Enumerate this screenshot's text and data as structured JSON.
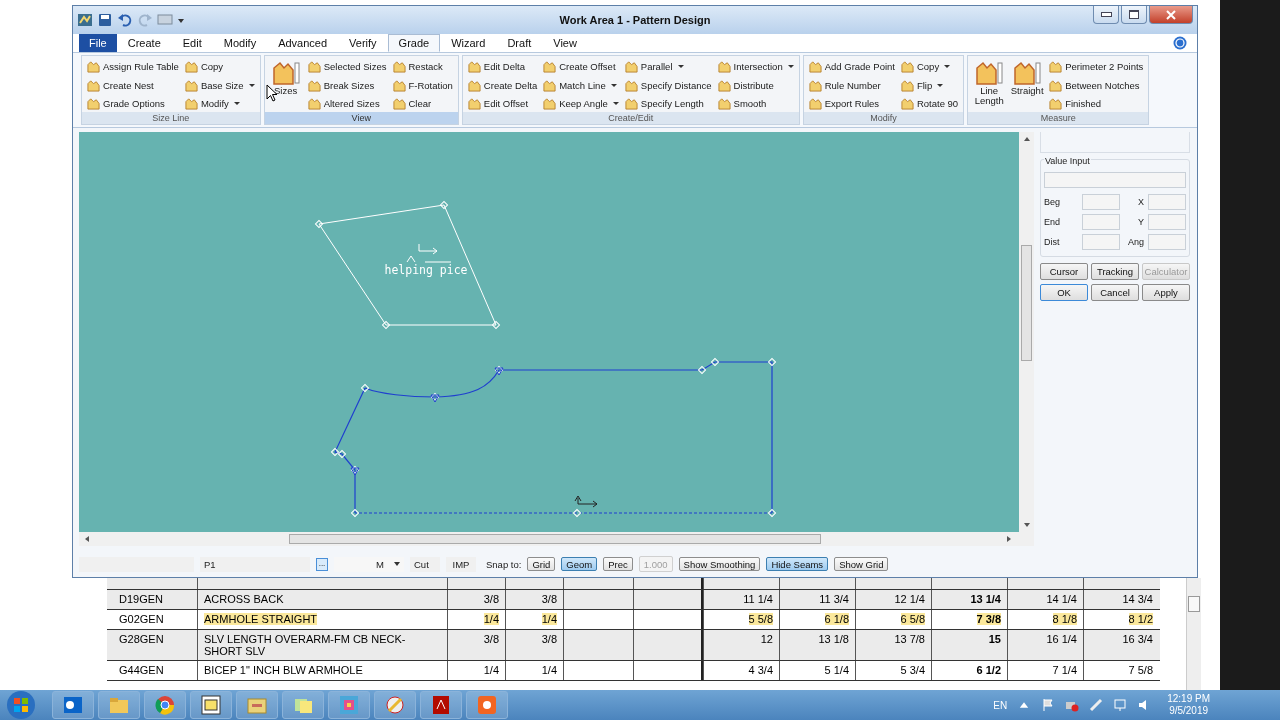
{
  "window": {
    "title": "Work Area 1 - Pattern Design"
  },
  "tabs": [
    {
      "label": "File",
      "kind": "file",
      "selected": false
    },
    {
      "label": "Create",
      "kind": "tab",
      "selected": false
    },
    {
      "label": "Edit",
      "kind": "tab",
      "selected": false
    },
    {
      "label": "Modify",
      "kind": "tab",
      "selected": false
    },
    {
      "label": "Advanced",
      "kind": "tab",
      "selected": false
    },
    {
      "label": "Verify",
      "kind": "tab",
      "selected": false
    },
    {
      "label": "Grade",
      "kind": "tab",
      "selected": true
    },
    {
      "label": "Wizard",
      "kind": "tab",
      "selected": false
    },
    {
      "label": "Draft",
      "kind": "tab",
      "selected": false
    },
    {
      "label": "View",
      "kind": "tab",
      "selected": false
    }
  ],
  "ribbon": [
    {
      "label": "Size Line",
      "columns": [
        [
          {
            "label": "Assign Rule Table",
            "kind": "small",
            "dropdown": false
          },
          {
            "label": "Create Nest",
            "kind": "small",
            "dropdown": false
          },
          {
            "label": "Grade Options",
            "kind": "small",
            "dropdown": false
          }
        ],
        [
          {
            "label": "Copy",
            "kind": "small",
            "dropdown": false
          },
          {
            "label": "Base Size",
            "kind": "small",
            "dropdown": true
          },
          {
            "label": "Modify",
            "kind": "small",
            "dropdown": true
          }
        ]
      ]
    },
    {
      "label": "View",
      "columns": [
        [
          {
            "label": "Sizes",
            "kind": "large"
          }
        ],
        [
          {
            "label": "Selected Sizes",
            "kind": "small",
            "dropdown": false
          },
          {
            "label": "Break Sizes",
            "kind": "small",
            "dropdown": false
          },
          {
            "label": "Altered Sizes",
            "kind": "small",
            "dropdown": false
          }
        ],
        [
          {
            "label": "Restack",
            "kind": "small",
            "dropdown": false
          },
          {
            "label": "F-Rotation",
            "kind": "small",
            "dropdown": false
          },
          {
            "label": "Clear",
            "kind": "small",
            "dropdown": false
          }
        ]
      ]
    },
    {
      "label": "Create/Edit",
      "columns": [
        [
          {
            "label": "Edit Delta",
            "kind": "small",
            "dropdown": false
          },
          {
            "label": "Create Delta",
            "kind": "small",
            "dropdown": false
          },
          {
            "label": "Edit Offset",
            "kind": "small",
            "dropdown": false
          }
        ],
        [
          {
            "label": "Create Offset",
            "kind": "small",
            "dropdown": false
          },
          {
            "label": "Match Line",
            "kind": "small",
            "dropdown": true
          },
          {
            "label": "Keep Angle",
            "kind": "small",
            "dropdown": true
          }
        ],
        [
          {
            "label": "Parallel",
            "kind": "small",
            "dropdown": true
          },
          {
            "label": "Specify Distance",
            "kind": "small",
            "dropdown": false
          },
          {
            "label": "Specify Length",
            "kind": "small",
            "dropdown": false
          }
        ],
        [
          {
            "label": "Intersection",
            "kind": "small",
            "dropdown": true
          },
          {
            "label": "Distribute",
            "kind": "small",
            "dropdown": false
          },
          {
            "label": "Smooth",
            "kind": "small",
            "dropdown": false
          }
        ]
      ]
    },
    {
      "label": "Modify",
      "columns": [
        [
          {
            "label": "Add Grade Point",
            "kind": "small",
            "dropdown": false
          },
          {
            "label": "Rule Number",
            "kind": "small",
            "dropdown": false
          },
          {
            "label": "Export Rules",
            "kind": "small",
            "dropdown": false
          }
        ],
        [
          {
            "label": "Copy",
            "kind": "small",
            "dropdown": true
          },
          {
            "label": "Flip",
            "kind": "small",
            "dropdown": true
          },
          {
            "label": "Rotate 90",
            "kind": "small",
            "dropdown": false
          }
        ]
      ]
    },
    {
      "label": "Measure",
      "columns": [
        [
          {
            "label": "Line Length",
            "kind": "large"
          }
        ],
        [
          {
            "label": "Straight",
            "kind": "large"
          }
        ],
        [
          {
            "label": "Perimeter 2 Points",
            "kind": "small",
            "dropdown": false
          },
          {
            "label": "Between Notches",
            "kind": "small",
            "dropdown": false
          },
          {
            "label": "Finished",
            "kind": "small",
            "dropdown": false
          }
        ]
      ]
    }
  ],
  "canvas": {
    "piece_label": "helping pice"
  },
  "value_panel": {
    "title": "Value Input",
    "left_labels": [
      "Beg",
      "End",
      "Dist"
    ],
    "right_labels": [
      "X",
      "Y",
      "Ang"
    ],
    "buttons": [
      {
        "label": "Cursor",
        "disabled": false
      },
      {
        "label": "Tracking",
        "disabled": false
      },
      {
        "label": "Calculator",
        "disabled": true
      },
      {
        "label": "OK",
        "disabled": false
      },
      {
        "label": "Cancel",
        "disabled": false
      },
      {
        "label": "Apply",
        "disabled": false
      }
    ]
  },
  "status_bar": {
    "piece": "P1",
    "browse": "...",
    "unit": "M",
    "cut": "Cut",
    "imp": "IMP",
    "snap_label": "Snap to:",
    "snap": [
      {
        "label": "Grid",
        "pressed": false
      },
      {
        "label": "Geom",
        "pressed": true
      },
      {
        "label": "Prec",
        "pressed": false
      }
    ],
    "precision": "1.000",
    "toggles": [
      {
        "label": "Show Smoothing",
        "pressed": false
      },
      {
        "label": "Hide Seams",
        "pressed": true
      },
      {
        "label": "Show Grid",
        "pressed": false
      }
    ]
  },
  "table": {
    "rows": [
      {
        "code": "D19GEN",
        "description": "ACROSS BACK",
        "rules": [
          "3/8",
          "3/8"
        ],
        "sizes": [
          "11 1/4",
          "11 3/4",
          "12 1/4",
          "13 1/4",
          "14 1/4",
          "14 3/4"
        ],
        "highlighted": false
      },
      {
        "code": "G02GEN",
        "description": "ARMHOLE STRAIGHT",
        "rules": [
          "1/4",
          "1/4"
        ],
        "sizes": [
          "5 5/8",
          "6 1/8",
          "6 5/8",
          "7 3/8",
          "8 1/8",
          "8 1/2"
        ],
        "highlighted": true
      },
      {
        "code": "G28GEN",
        "description": "SLV LENGTH OVERARM-FM CB NECK-SHORT SLV",
        "rules": [
          "3/8",
          "3/8"
        ],
        "sizes": [
          "12",
          "13 1/8",
          "13 7/8",
          "15",
          "16 1/4",
          "16 3/4"
        ],
        "highlighted": false
      },
      {
        "code": "G44GEN",
        "description": "BICEP 1\" INCH BLW ARMHOLE",
        "rules": [
          "1/4",
          "1/4"
        ],
        "sizes": [
          "4 3/4",
          "5 1/4",
          "5 3/4",
          "6 1/2",
          "7 1/4",
          "7 5/8"
        ],
        "highlighted": false
      }
    ]
  },
  "taskbar": {
    "language": "EN",
    "time": "12:19 PM",
    "date": "9/5/2019"
  }
}
